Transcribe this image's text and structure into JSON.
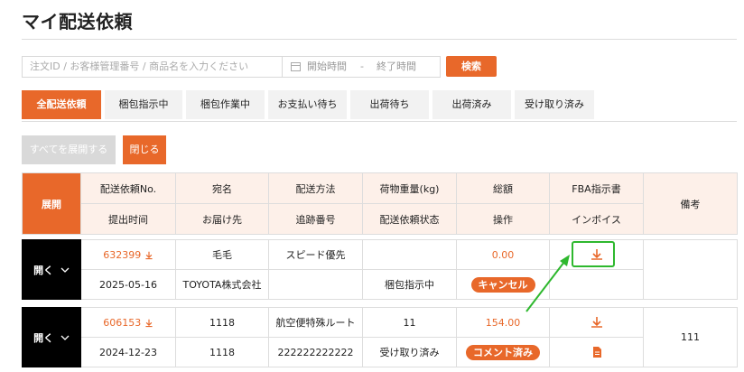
{
  "page_title": "マイ配送依頼",
  "search": {
    "placeholder": "注文ID / お客様管理番号 / 商品名を入力ください"
  },
  "date_range": {
    "start": "開始時間",
    "sep": "-",
    "end": "終了時間"
  },
  "search_button": "検索",
  "tabs": [
    {
      "label": "全配送依頼",
      "active": true
    },
    {
      "label": "梱包指示中"
    },
    {
      "label": "梱包作業中"
    },
    {
      "label": "お支払い待ち"
    },
    {
      "label": "出荷待ち"
    },
    {
      "label": "出荷済み"
    },
    {
      "label": "受け取り済み"
    }
  ],
  "actions": {
    "expand_all": "すべてを展開する",
    "close": "閉じる"
  },
  "table": {
    "header": {
      "expand": "展開",
      "row1": [
        "配送依頼No.",
        "宛名",
        "配送方法",
        "荷物重量(kg)",
        "総額",
        "FBA指示書"
      ],
      "row2": [
        "提出时间",
        "お届け先",
        "追跡番号",
        "配送依頼状态",
        "操作",
        "インボイス"
      ],
      "remarks": "備考"
    },
    "orders": [
      {
        "open_label": "開く",
        "order_no": "632399",
        "name": "毛毛",
        "method": "スピード優先",
        "weight": "",
        "total": "0.00",
        "date": "2025-05-16",
        "address": "TOYOTA株式会社",
        "tracking": "",
        "status": "梱包指示中",
        "action": "キャンセル",
        "remarks": ""
      },
      {
        "open_label": "開く",
        "order_no": "606153",
        "name": "1118",
        "method": "航空便特殊ルート",
        "weight": "11",
        "total": "154.00",
        "date": "2024-12-23",
        "address": "1118",
        "tracking": "222222222222",
        "status": "受け取り済み",
        "action": "コメント済み",
        "remarks": "111"
      }
    ]
  },
  "colors": {
    "accent": "#e8682a",
    "highlight": "#2eb82e",
    "header_bg": "#fdf0e9"
  }
}
